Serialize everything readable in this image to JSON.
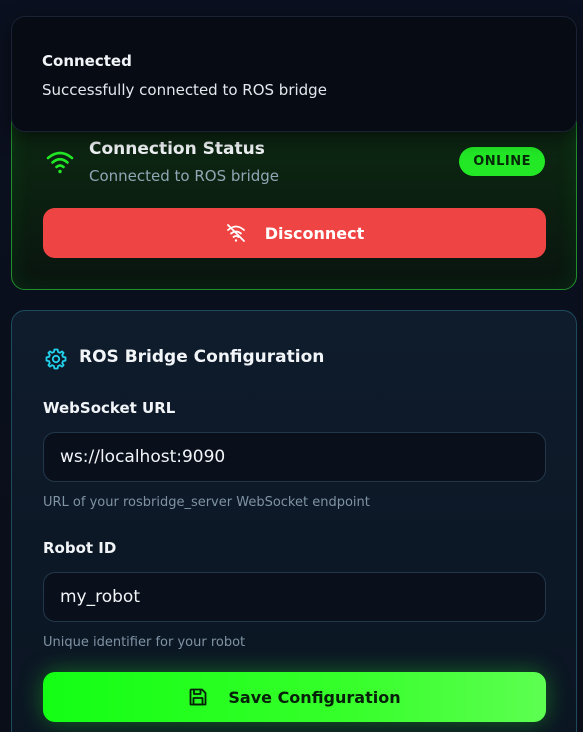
{
  "toast": {
    "title": "Connected",
    "description": "Successfully connected to ROS bridge"
  },
  "status": {
    "title": "Connection Status",
    "subtitle": "Connected to ROS bridge",
    "badge": "ONLINE",
    "disconnect_label": "Disconnect",
    "icons": {
      "status": "wifi-icon",
      "disconnect": "wifi-off-icon"
    },
    "colors": {
      "online": "#22e826",
      "danger": "#ef4444"
    }
  },
  "config": {
    "title": "ROS Bridge Configuration",
    "icon": "gear-icon",
    "fields": [
      {
        "label": "WebSocket URL",
        "value": "ws://localhost:9090",
        "help": "URL of your rosbridge_server WebSocket endpoint"
      },
      {
        "label": "Robot ID",
        "value": "my_robot",
        "help": "Unique identifier for your robot"
      }
    ],
    "save_label": "Save Configuration",
    "save_icon": "save-icon",
    "colors": {
      "accent": "#22d3ee",
      "save": "#13ff14"
    }
  }
}
